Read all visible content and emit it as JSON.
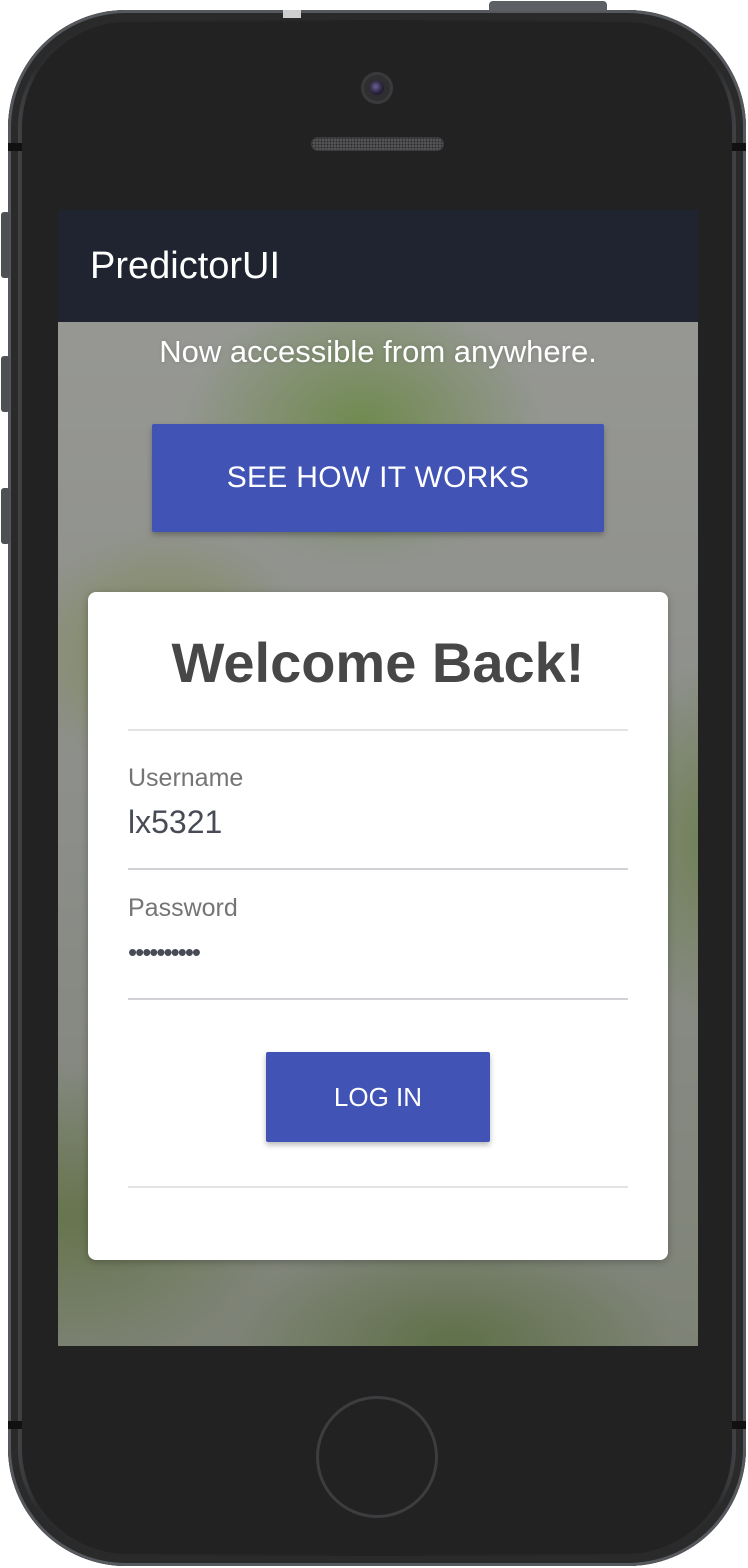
{
  "app": {
    "title": "PredictorUI"
  },
  "hero": {
    "tagline": "Now accessible from anywhere.",
    "cta_label": "SEE HOW IT WORKS"
  },
  "login": {
    "heading": "Welcome Back!",
    "username_label": "Username",
    "username_value": "lx5321",
    "password_label": "Password",
    "password_value": "••••••••••",
    "submit_label": "LOG IN"
  },
  "colors": {
    "app_bar": "#1f2430",
    "primary_button": "#4154b6",
    "card": "#ffffff",
    "heading_text": "#474747"
  },
  "icons": {
    "device_frame": "iphone-frame",
    "camera": "front-camera-icon",
    "speaker": "earpiece-speaker-icon",
    "home": "home-button-icon"
  }
}
